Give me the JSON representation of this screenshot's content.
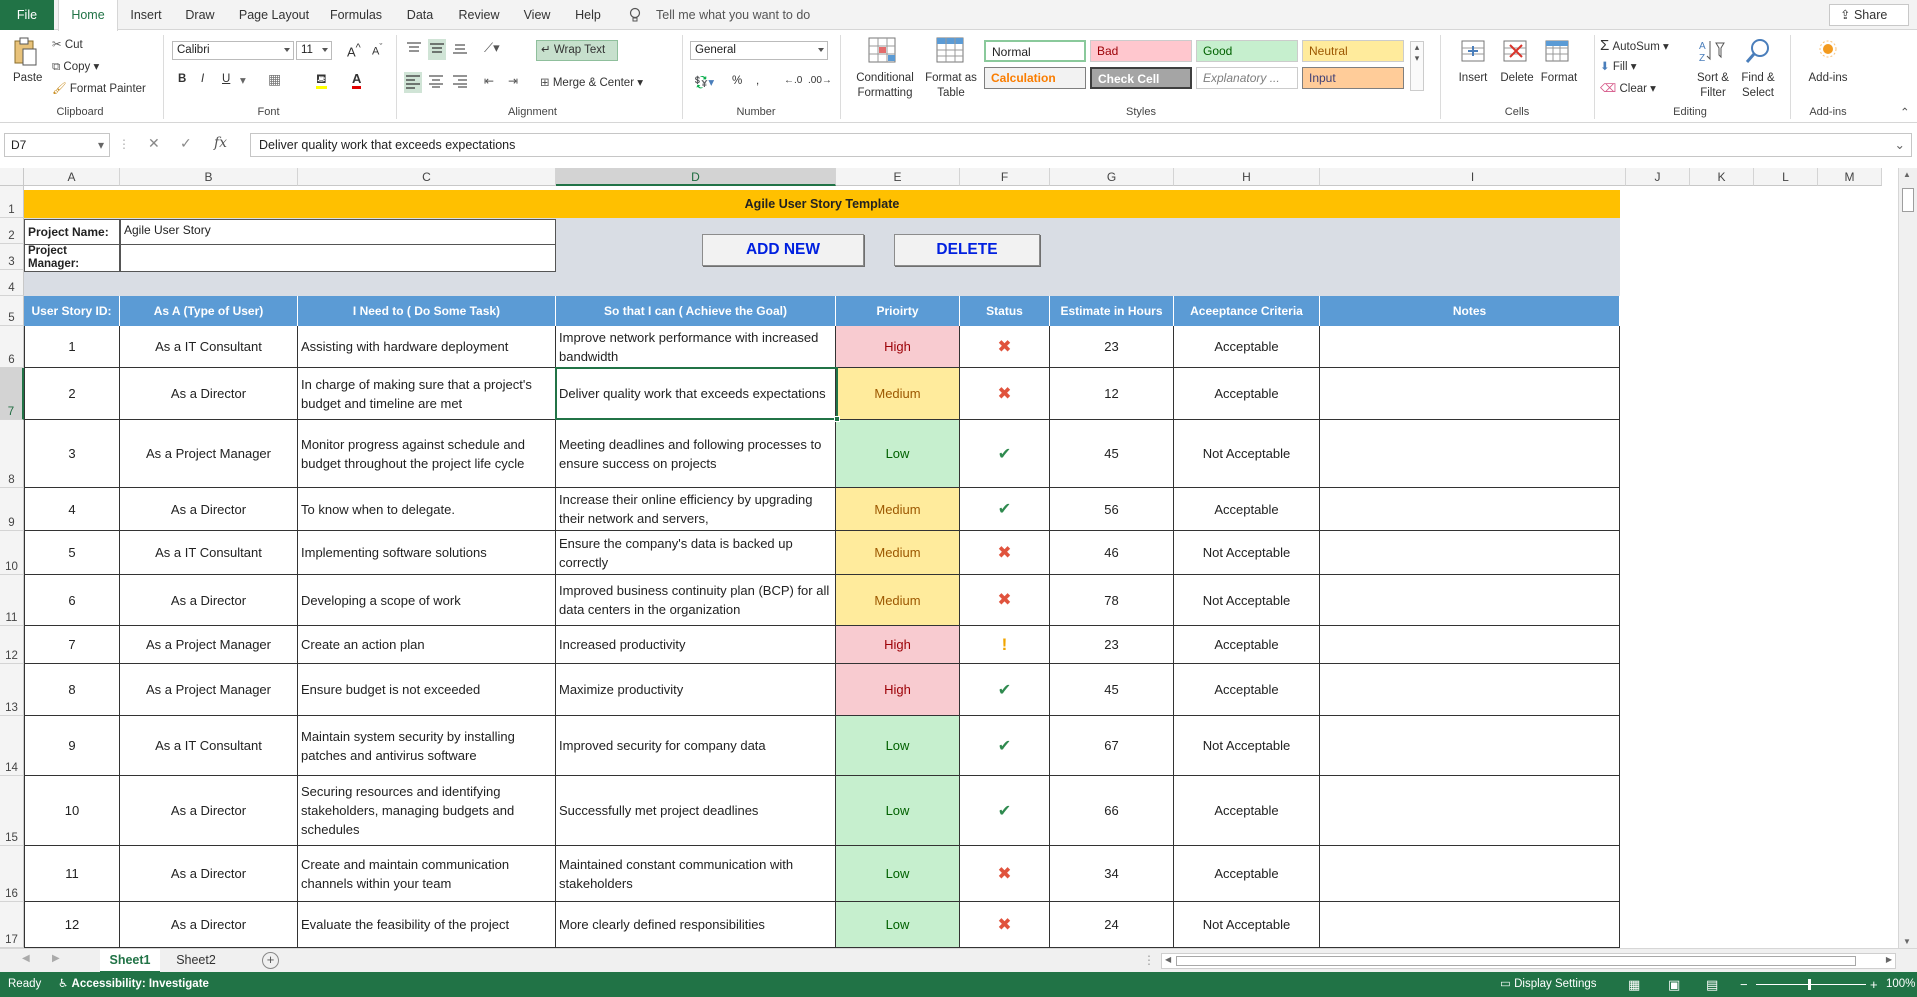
{
  "ribbon_tabs": [
    "File",
    "Home",
    "Insert",
    "Draw",
    "Page Layout",
    "Formulas",
    "Data",
    "Review",
    "View",
    "Help"
  ],
  "tell_me": "Tell me what you want to do",
  "share": "Share",
  "clipboard": {
    "paste": "Paste",
    "cut": "Cut",
    "copy": "Copy",
    "format_painter": "Format Painter",
    "label": "Clipboard"
  },
  "font": {
    "family": "Calibri",
    "size": "11",
    "bold": "B",
    "italic": "I",
    "underline": "U",
    "label": "Font"
  },
  "alignment": {
    "wrap_text": "Wrap Text",
    "merge_center": "Merge & Center",
    "label": "Alignment"
  },
  "number": {
    "format": "General",
    "label": "Number"
  },
  "styles": {
    "conditional_formatting": "Conditional Formatting",
    "format_as_table": "Format as Table",
    "cells": [
      {
        "name": "Normal"
      },
      {
        "name": "Bad"
      },
      {
        "name": "Good"
      },
      {
        "name": "Neutral"
      },
      {
        "name": "Calculation"
      },
      {
        "name": "Check Cell"
      },
      {
        "name": "Explanatory ..."
      },
      {
        "name": "Input"
      }
    ],
    "label": "Styles"
  },
  "cells_group": {
    "insert": "Insert",
    "delete": "Delete",
    "format": "Format",
    "label": "Cells"
  },
  "editing": {
    "autosum": "AutoSum",
    "fill": "Fill",
    "clear": "Clear",
    "sort_filter": "Sort & Filter",
    "find_select": "Find & Select",
    "label": "Editing"
  },
  "addins": {
    "button": "Add-ins",
    "label": "Add-ins"
  },
  "formula_bar": {
    "name_box": "D7",
    "fx": "fx",
    "content": "Deliver quality work that exceeds expectations"
  },
  "columns": [
    "A",
    "B",
    "C",
    "D",
    "E",
    "F",
    "G",
    "H",
    "I",
    "J",
    "K",
    "L",
    "M"
  ],
  "sheet": {
    "title": "Agile User Story Template",
    "project_name_label": "Project Name:",
    "project_name_value": "Agile User Story",
    "project_manager_label": "Project Manager:",
    "add_new": "ADD NEW",
    "delete": "DELETE",
    "headers": [
      "User Story ID:",
      "As A (Type of User)",
      "I Need to ( Do Some Task)",
      "So that I can ( Achieve the Goal)",
      "Prioirty",
      "Status",
      "Estimate in Hours",
      "Aceeptance Criteria",
      "Notes"
    ],
    "rows": [
      {
        "id": "1",
        "user": "As a IT Consultant",
        "task": "Assisting with hardware deployment",
        "goal": "Improve network performance with increased bandwidth",
        "priority": "High",
        "status": "✖",
        "hours": "23",
        "criteria": "Acceptable"
      },
      {
        "id": "2",
        "user": "As a Director",
        "task": "In charge of making sure that a project's budget and timeline are met",
        "goal": "Deliver quality work that exceeds expectations",
        "priority": "Medium",
        "status": "✖",
        "hours": "12",
        "criteria": "Acceptable"
      },
      {
        "id": "3",
        "user": "As a Project Manager",
        "task": "Monitor progress against schedule and budget throughout the project life cycle",
        "goal": "Meeting deadlines and following processes to ensure success on projects",
        "priority": "Low",
        "status": "✔",
        "hours": "45",
        "criteria": "Not Acceptable"
      },
      {
        "id": "4",
        "user": "As a Director",
        "task": " To know when to delegate.",
        "goal": "Increase their online efficiency by upgrading their network and servers,",
        "priority": "Medium",
        "status": "✔",
        "hours": "56",
        "criteria": "Acceptable"
      },
      {
        "id": "5",
        "user": "As a IT Consultant",
        "task": "Implementing software solutions",
        "goal": "Ensure the company's data is backed up correctly",
        "priority": "Medium",
        "status": "✖",
        "hours": "46",
        "criteria": "Not Acceptable"
      },
      {
        "id": "6",
        "user": "As a Director",
        "task": "Developing a scope of work",
        "goal": " Improved business continuity plan (BCP) for all data centers in the organization",
        "priority": "Medium",
        "status": "✖",
        "hours": "78",
        "criteria": "Not Acceptable"
      },
      {
        "id": "7",
        "user": "As a Project Manager",
        "task": "Create an action plan",
        "goal": "Increased productivity",
        "priority": "High",
        "status": "!",
        "hours": "23",
        "criteria": "Acceptable"
      },
      {
        "id": "8",
        "user": "As a Project Manager",
        "task": "Ensure budget is not exceeded",
        "goal": "Maximize productivity",
        "priority": "High",
        "status": "✔",
        "hours": "45",
        "criteria": "Acceptable"
      },
      {
        "id": "9",
        "user": "As a IT Consultant",
        "task": " Maintain system security by installing patches and antivirus software",
        "goal": " Improved security for company data",
        "priority": "Low",
        "status": "✔",
        "hours": "67",
        "criteria": "Not Acceptable"
      },
      {
        "id": "10",
        "user": "As a Director",
        "task": "Securing resources and identifying stakeholders, managing budgets and schedules",
        "goal": "Successfully met project deadlines",
        "priority": "Low",
        "status": "✔",
        "hours": "66",
        "criteria": "Acceptable"
      },
      {
        "id": "11",
        "user": "As a Director",
        "task": " Create and maintain communication channels within your team",
        "goal": " Maintained constant communication with stakeholders",
        "priority": "Low",
        "status": "✖",
        "hours": "34",
        "criteria": "Acceptable"
      },
      {
        "id": "12",
        "user": "As a Director",
        "task": "Evaluate the feasibility of the project",
        "goal": "More clearly defined responsibilities",
        "priority": "Low",
        "status": "✖",
        "hours": "24",
        "criteria": "Not Acceptable"
      }
    ]
  },
  "row_numbers": [
    "1",
    "2",
    "3",
    "4",
    "5",
    "6",
    "7",
    "8",
    "9",
    "10",
    "11",
    "12",
    "13",
    "14",
    "15",
    "16",
    "17"
  ],
  "sheet_tabs": [
    "Sheet1",
    "Sheet2"
  ],
  "status_bar": {
    "ready": "Ready",
    "accessibility": "Accessibility: Investigate",
    "display_settings": "Display Settings",
    "zoom": "100%"
  },
  "colors": {
    "excel_green": "#217346",
    "title_fill": "#ffc000",
    "header_fill": "#5b9bd5",
    "high": "#f8cbd0",
    "medium": "#ffeb9c",
    "low": "#c6efce"
  }
}
